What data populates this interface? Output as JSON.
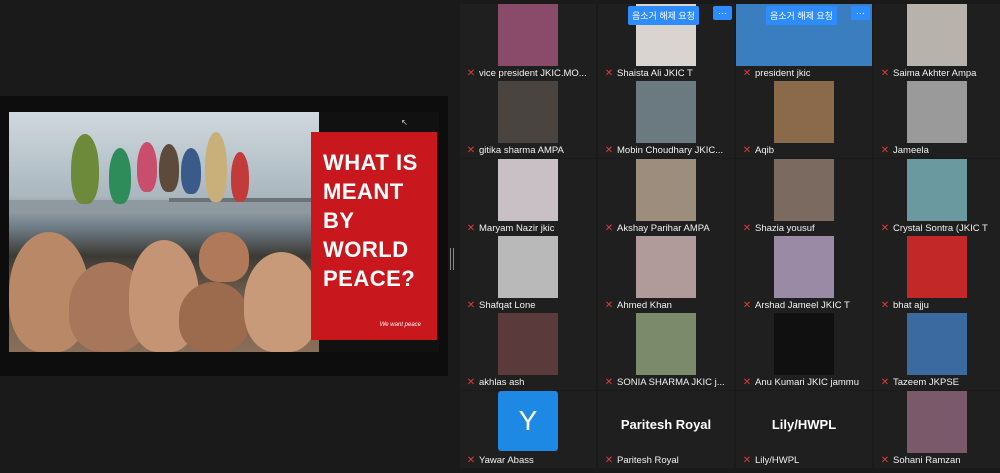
{
  "slide": {
    "title": "WHAT IS\nMEANT\nBY WORLD\nPEACE?",
    "tagline": "We want peace",
    "title_bg": "#c8171d"
  },
  "gallery": {
    "unmute_label": "음소거 해제 요청",
    "more_label": "···",
    "participants": [
      {
        "name": "vice president JKIC.MO...",
        "video": "#8a4a6a"
      },
      {
        "name": "Shaista Ali JKIC T",
        "video": "#d9d4cf"
      },
      {
        "name": "president jkic",
        "video": "#3a7ec0"
      },
      {
        "name": "Saima  Akhter  Ampa",
        "video": "#b8b2ad"
      },
      {
        "name": "gitika sharma AMPA",
        "video": "#4a4440"
      },
      {
        "name": "Mobin Choudhary JKIC...",
        "video": "#6b7a80"
      },
      {
        "name": "Aqib",
        "video": "#8a6a4a"
      },
      {
        "name": "Jameela",
        "video": "#9a9a9a"
      },
      {
        "name": "Maryam Nazir jkic",
        "video": "#c8c0c4"
      },
      {
        "name": "Akshay Parihar AMPA",
        "video": "#9d8d7d"
      },
      {
        "name": "Shazia yousuf",
        "video": "#7a6a60"
      },
      {
        "name": "Crystal Sontra  (JKIC T",
        "video": "#6a9aa0"
      },
      {
        "name": "Shafqat Lone",
        "video": "#b9b9b9"
      },
      {
        "name": "Ahmed Khan",
        "video": "#b09a9a"
      },
      {
        "name": "Arshad Jameel JKIC T",
        "video": "#9a8aa6"
      },
      {
        "name": "bhat ajju",
        "video": "#c22828"
      },
      {
        "name": "akhlas ash",
        "video": "#5a3a3a"
      },
      {
        "name": "SONIA SHARMA JKIC j...",
        "video": "#7a8a6a"
      },
      {
        "name": "Anu Kumari JKIC jammu",
        "video": "#101010"
      },
      {
        "name": "Tazeem JKPSE",
        "video": "#3a6aa0"
      },
      {
        "name": "Yawar Abass",
        "video": "#1e88e5"
      },
      {
        "name": "Paritesh Royal",
        "video": ""
      },
      {
        "name": "Lily/HWPL",
        "video": ""
      },
      {
        "name": "Sohani Ramzan",
        "video": "#7a5a6a"
      }
    ],
    "avatar_letter": "Y",
    "big_names": [
      "Paritesh Royal",
      "Lily/HWPL"
    ]
  }
}
